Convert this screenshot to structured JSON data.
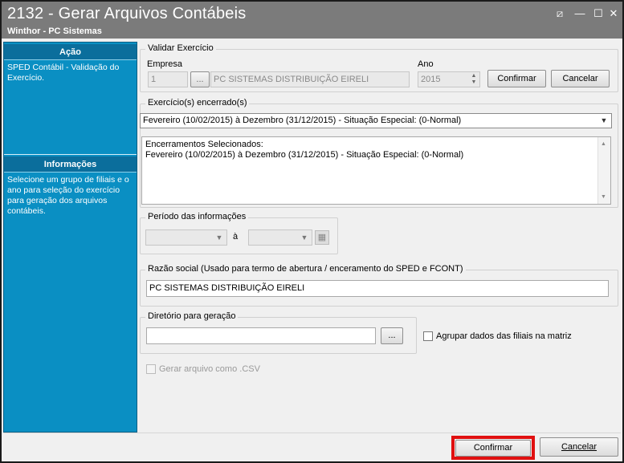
{
  "window": {
    "title": "2132 - Gerar Arquivos Contábeis",
    "subtitle": "Winthor - PC Sistemas",
    "buttons": {
      "restore": "⧄",
      "minimize": "—",
      "maximize": "☐",
      "close": "✕"
    }
  },
  "sidebar": {
    "acao_header": "Ação",
    "acao_text": "SPED Contábil - Validação do Exercício.",
    "info_header": "Informações",
    "info_text": "Selecione um grupo de filiais e o ano para seleção do exercício para geração dos arquivos contábeis."
  },
  "validar": {
    "legend": "Validar Exercício",
    "empresa_label": "Empresa",
    "empresa_code": "1",
    "lookup_button": "...",
    "empresa_name": "PC SISTEMAS DISTRIBUIÇÃO  EIRELI",
    "ano_label": "Ano",
    "ano_value": "2015",
    "confirmar_label": "Confirmar",
    "cancelar_label": "Cancelar"
  },
  "exercicio": {
    "legend": "Exercício(s) encerrado(s)",
    "selected": "Fevereiro (10/02/2015) à Dezembro (31/12/2015) - Situação Especial:  (0-Normal)",
    "encerramentos_title": "Encerramentos Selecionados:",
    "encerramentos_items": [
      "Fevereiro (10/02/2015) à Dezembro (31/12/2015) - Situação Especial:  (0-Normal)"
    ]
  },
  "periodo": {
    "legend": "Período das informações",
    "separator": "à",
    "start": "",
    "end": ""
  },
  "razao": {
    "legend": "Razão social (Usado para termo de abertura / enceramento do SPED e FCONT)",
    "value": "PC SISTEMAS DISTRIBUIÇÃO  EIRELI"
  },
  "diretorio": {
    "legend": "Diretório para geração",
    "value": "",
    "browse_button": "..."
  },
  "agrupar_label": "Agrupar dados das filiais na matriz",
  "csv_label": "Gerar arquivo como .CSV",
  "footer": {
    "confirmar_label": "Confirmar",
    "cancelar_label": "Cancelar"
  },
  "colors": {
    "titlebar": "#7b7b7b",
    "sidebar": "#0a8fc3",
    "highlight": "#e01010"
  }
}
